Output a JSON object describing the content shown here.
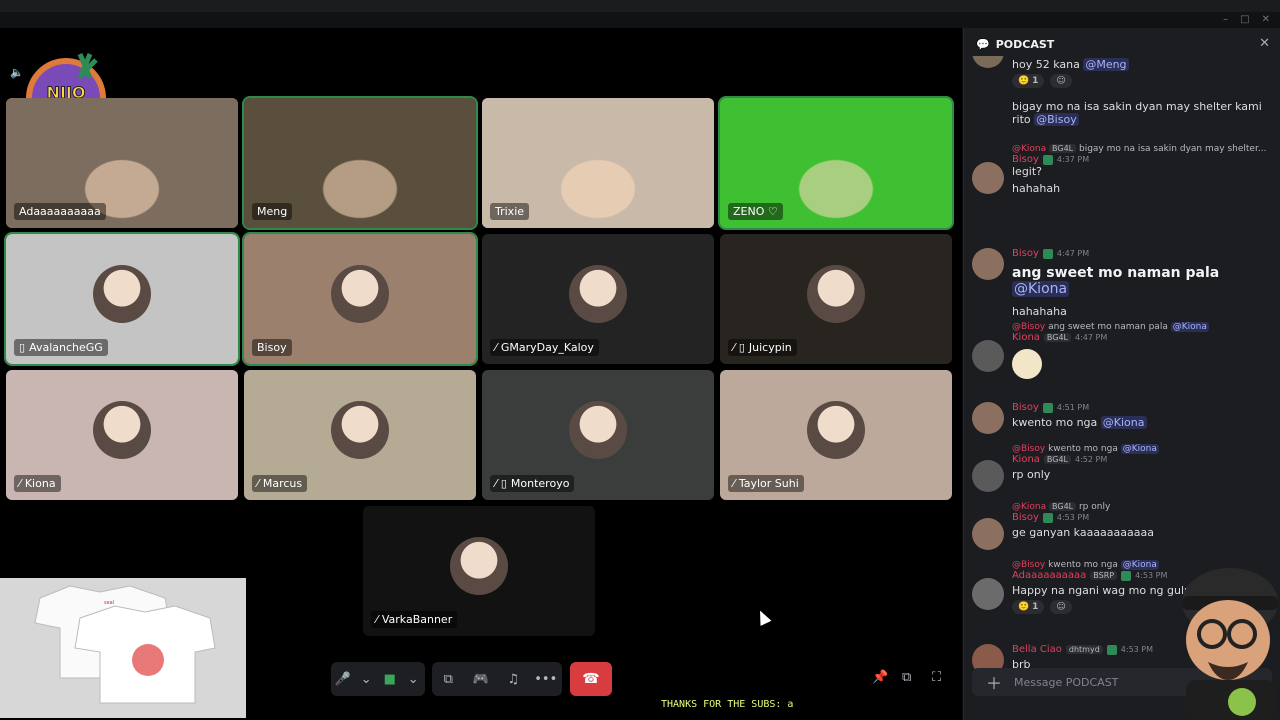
{
  "window": {
    "minimize": "–",
    "maximize": "□",
    "close": "✕"
  },
  "stage": {
    "speaker_icon": "speaker-icon",
    "logo_text": "NIJO PLAYS",
    "tiles": [
      {
        "name": "Adaaaaaaaaaa",
        "kind": "camera",
        "bg": "#7d6d5e",
        "active": false,
        "muted": false
      },
      {
        "name": "Meng",
        "kind": "camera",
        "bg": "#5a4e3c",
        "active": true,
        "muted": false
      },
      {
        "name": "Trixie",
        "kind": "camera",
        "bg": "#c9b9a8",
        "active": false,
        "muted": false
      },
      {
        "name": "ZENO ♡",
        "kind": "camera",
        "bg": "#3fbf32",
        "active": true,
        "muted": false
      },
      {
        "name": "AvalancheGG",
        "kind": "avatar",
        "bg": "#c4c4c4",
        "active": true,
        "muted": false,
        "mobile": true
      },
      {
        "name": "Bisoy",
        "kind": "avatar",
        "bg": "#9c806e",
        "active": true,
        "muted": false
      },
      {
        "name": "GMaryDay_Kaloy",
        "kind": "avatar",
        "bg": "#232323",
        "active": false,
        "muted": true
      },
      {
        "name": "Juicypin",
        "kind": "avatar",
        "bg": "#282420",
        "active": false,
        "muted": true,
        "mobile": true
      },
      {
        "name": "Kiona",
        "kind": "avatar",
        "bg": "#c9b6b3",
        "active": false,
        "muted": true
      },
      {
        "name": "Marcus",
        "kind": "avatar",
        "bg": "#b5aa94",
        "active": false,
        "muted": true
      },
      {
        "name": "Monteroyo",
        "kind": "avatar",
        "bg": "#3a3d3c",
        "active": false,
        "muted": true,
        "mobile": true
      },
      {
        "name": "Taylor Suhi",
        "kind": "avatar",
        "bg": "#bda99c",
        "active": false,
        "muted": true
      },
      {
        "name": "VarkaBanner",
        "kind": "avatar",
        "bg": "#121212",
        "active": false,
        "muted": true
      }
    ],
    "overlay_promo": "shirt-promo-image"
  },
  "controls": {
    "mic": "microphone-icon",
    "camera": "camera-icon",
    "screen": "screen-share-icon",
    "activity": "activity-icon",
    "soundboard": "soundboard-icon",
    "more": "•••",
    "leave": "leave-call-icon",
    "pin": "pin-icon",
    "popout": "popout-icon",
    "fullscreen": "fullscreen-icon"
  },
  "ticker": "THANKS FOR THE SUBS: a",
  "panel": {
    "title": "PODCAST",
    "close": "✕",
    "composer_placeholder": "Message PODCAST"
  },
  "messages": [
    {
      "text": "hoy 52 kana ",
      "mention": "@Meng",
      "reaction": "1"
    },
    {
      "text": "bigay mo na isa sakin dyan may shelter kami rito ",
      "mention": "@Bisoy"
    },
    {
      "reply_author": "@Kiona",
      "reply_tag": "BG4L",
      "reply_text": "bigay mo na isa sakin dyan may shelter...",
      "author": "Bisoy",
      "time": "4:37 PM",
      "lines": [
        "legit?",
        "hahahah"
      ]
    },
    {
      "author": "Bisoy",
      "time": "4:47 PM",
      "big": "ang sweet mo naman pala ",
      "mention": "@Kiona",
      "line2": "hahahaha"
    },
    {
      "reply_author": "@Bisoy",
      "reply_text": "ang sweet mo naman pala ",
      "reply_mention": "@Kiona",
      "author": "Kiona",
      "tag": "BG4L",
      "time": "4:47 PM"
    },
    {
      "author": "Bisoy",
      "time": "4:51 PM",
      "text": "kwento mo nga ",
      "mention": "@Kiona"
    },
    {
      "reply_author": "@Bisoy",
      "reply_text": "kwento mo nga ",
      "reply_mention": "@Kiona",
      "author": "Kiona",
      "tag": "BG4L",
      "time": "4:52 PM",
      "text": "rp only"
    },
    {
      "reply_author": "@Kiona",
      "reply_tag": "BG4L",
      "reply_text": "rp only",
      "author": "Bisoy",
      "time": "4:53 PM",
      "text": "ge ganyan kaaaaaaaaaaa"
    },
    {
      "reply_author": "@Bisoy",
      "reply_text": "kwento mo nga ",
      "reply_mention": "@Kiona",
      "author": "Adaaaaaaaaaa",
      "tag": "BSRP",
      "time": "4:53 PM",
      "text": "Happy na ngani wag mo ng guluhin kupal",
      "reaction": "1"
    },
    {
      "author": "Bella Ciao",
      "tag": "dhtmyd",
      "time": "4:53 PM",
      "text": "brb"
    }
  ]
}
